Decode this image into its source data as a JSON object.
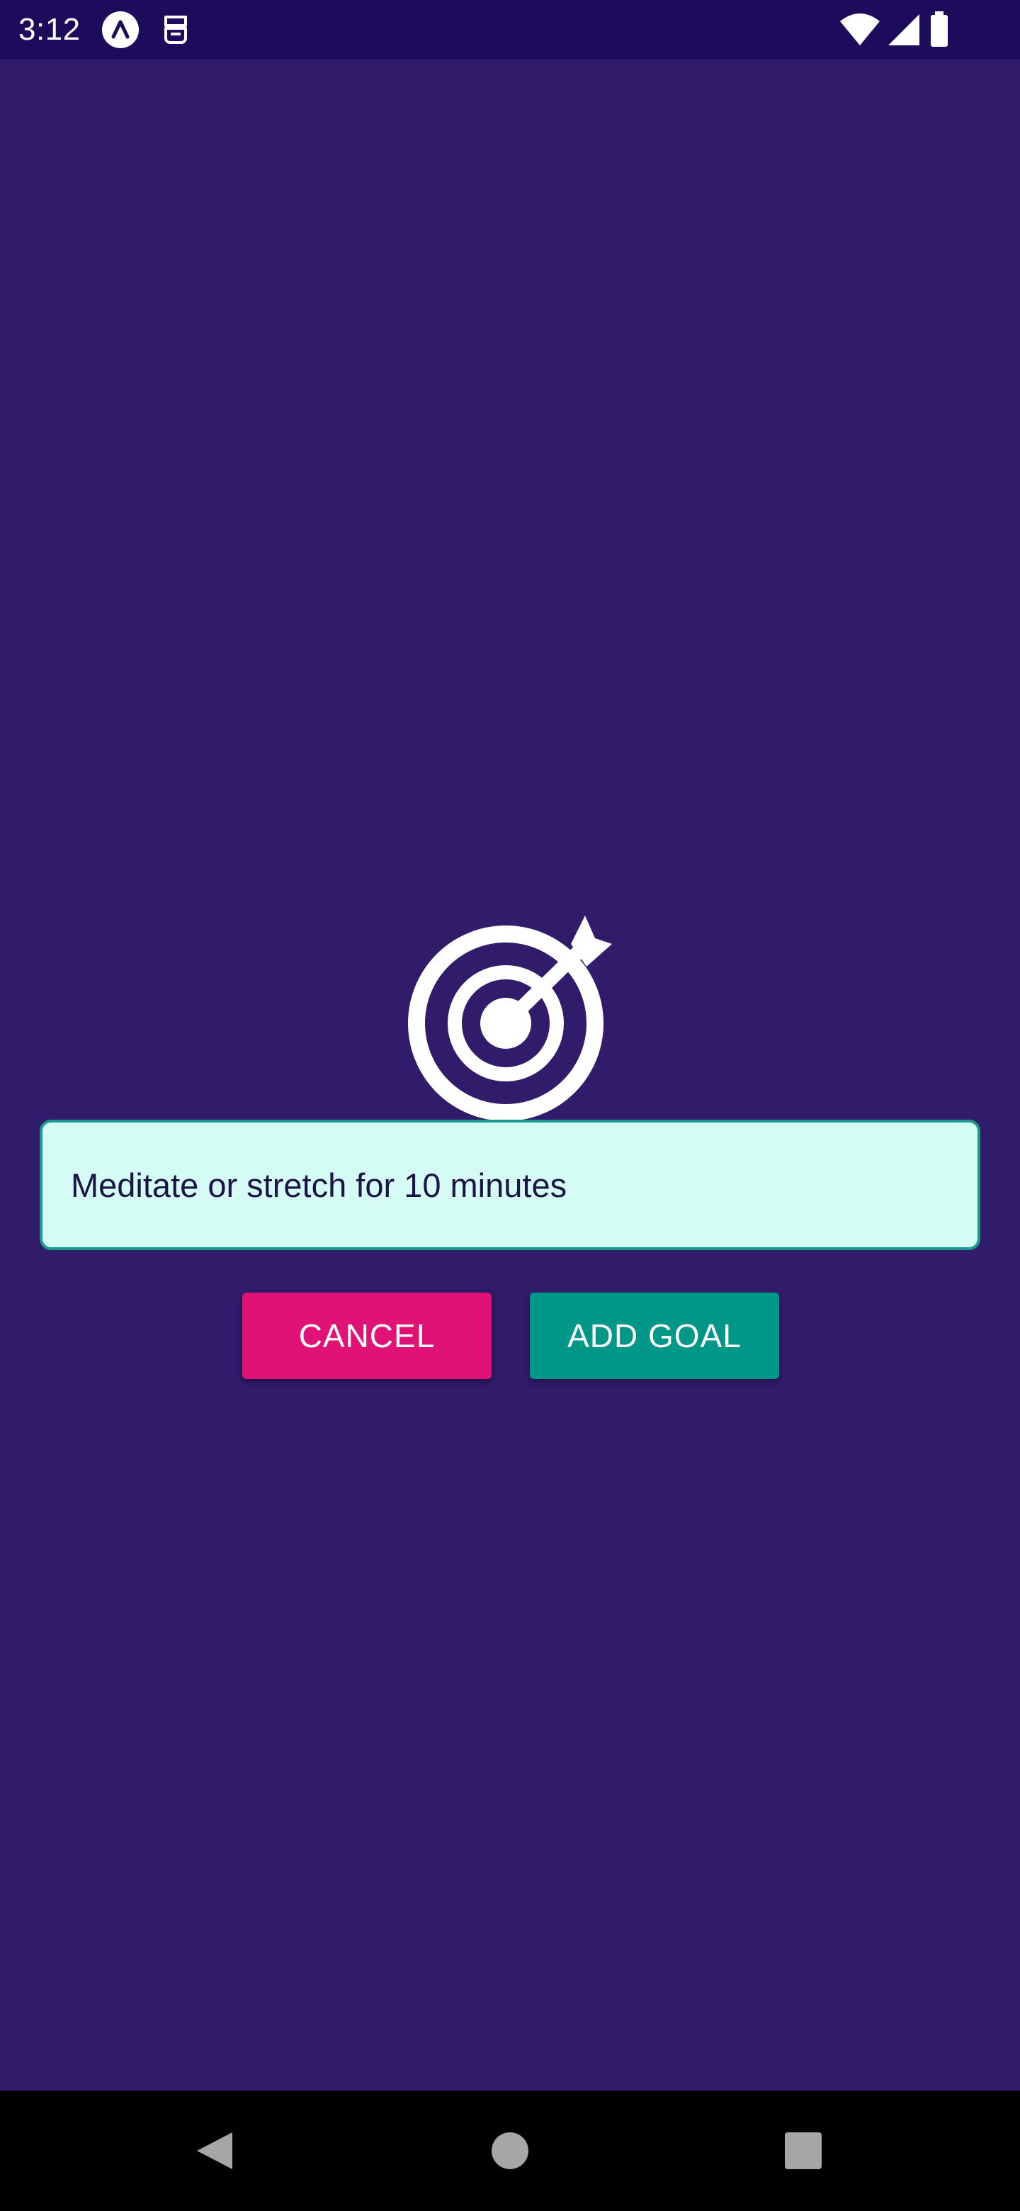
{
  "status_bar": {
    "time": "3:12",
    "icons": [
      "app-notification-icon",
      "sim-card-icon",
      "wifi-icon",
      "signal-icon",
      "battery-icon"
    ]
  },
  "goal_icon": "target-arrow-icon",
  "goal_input": {
    "value": "Meditate or stretch for 10 minutes",
    "placeholder": ""
  },
  "buttons": {
    "cancel_label": "CANCEL",
    "add_goal_label": "ADD GOAL"
  },
  "navigation": {
    "icons": [
      "back-icon",
      "home-icon",
      "recents-icon"
    ]
  },
  "colors": {
    "background": "#311b6b",
    "status_bar": "#1d0b5c",
    "cancel": "#e11276",
    "add_goal": "#009688",
    "input_background": "#d4fbf4",
    "input_border": "#1d9a8c"
  }
}
